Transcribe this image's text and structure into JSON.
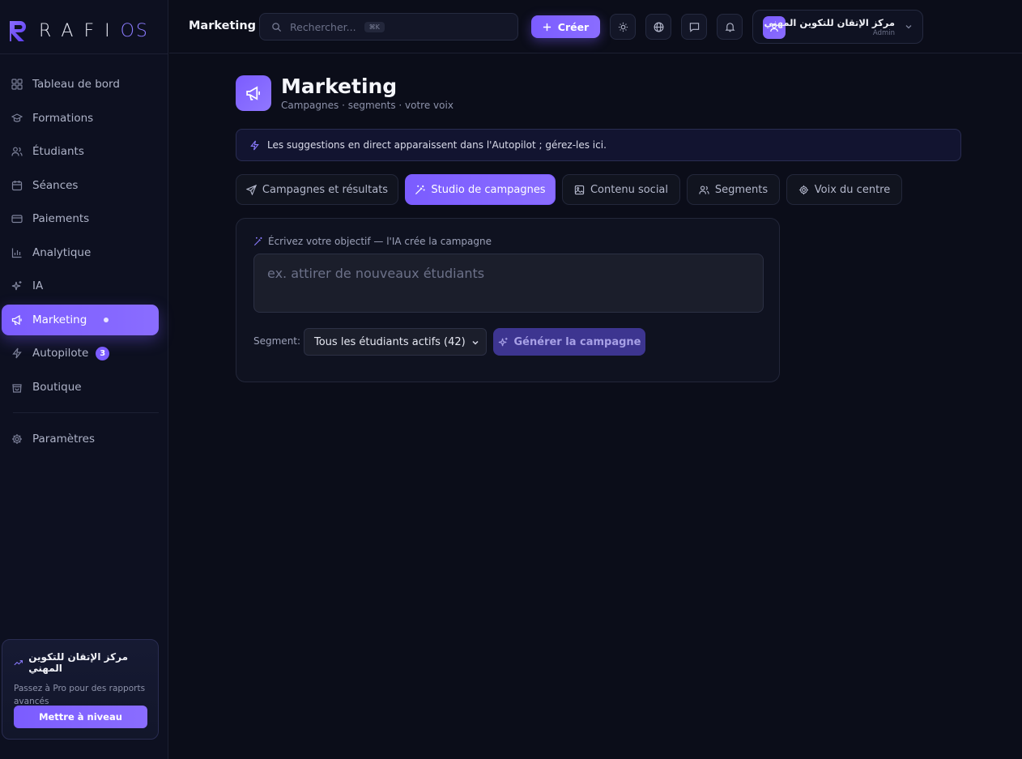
{
  "brand": {
    "logo_text": "RAFI",
    "logo_suffix": "OS",
    "accent": "#7b5cff"
  },
  "sidebar": {
    "items": [
      {
        "label": "Tableau de bord",
        "icon": "grid-icon"
      },
      {
        "label": "Formations",
        "icon": "graduation-cap-icon"
      },
      {
        "label": "Étudiants",
        "icon": "users-icon"
      },
      {
        "label": "Séances",
        "icon": "calendar-icon"
      },
      {
        "label": "Paiements",
        "icon": "credit-card-icon"
      },
      {
        "label": "Analytique",
        "icon": "bar-chart-icon"
      },
      {
        "label": "IA",
        "icon": "sparkles-icon"
      },
      {
        "label": "Marketing",
        "icon": "megaphone-icon",
        "active": true
      },
      {
        "label": "Autopilote",
        "icon": "zap-icon",
        "badge": "3"
      },
      {
        "label": "Boutique",
        "icon": "shopping-bag-icon"
      }
    ],
    "settings_label": "Paramètres",
    "promo": {
      "title": "مركز الإتقان للتكوين المهني",
      "text": "Passez à Pro pour des rapports avancés",
      "button": "Mettre à niveau"
    }
  },
  "header": {
    "title": "Marketing",
    "search_placeholder": "Rechercher...",
    "search_shortcut": "⌘K",
    "create_label": "Créer",
    "user_name": "مركز الإتقان للتكوين المهني",
    "user_role": "Admin"
  },
  "page": {
    "title": "Marketing",
    "subtitle": "Campagnes · segments · votre voix",
    "info": "Les suggestions en direct apparaissent dans l'Autopilot ; gérez-les ici."
  },
  "tabs": [
    {
      "label": "Campagnes et résultats",
      "icon": "send-icon"
    },
    {
      "label": "Studio de campagnes",
      "icon": "wand-icon",
      "active": true
    },
    {
      "label": "Contenu social",
      "icon": "image-icon"
    },
    {
      "label": "Segments",
      "icon": "users-icon"
    },
    {
      "label": "Voix du centre",
      "icon": "gear-icon"
    }
  ],
  "studio": {
    "goal_label": "Écrivez votre objectif — l'IA crée la campagne",
    "goal_placeholder": "ex. attirer de nouveaux étudiants",
    "segment_label": "Segment:",
    "segment_value": "Tous les étudiants actifs (42)",
    "generate_label": "Générer la campagne"
  }
}
